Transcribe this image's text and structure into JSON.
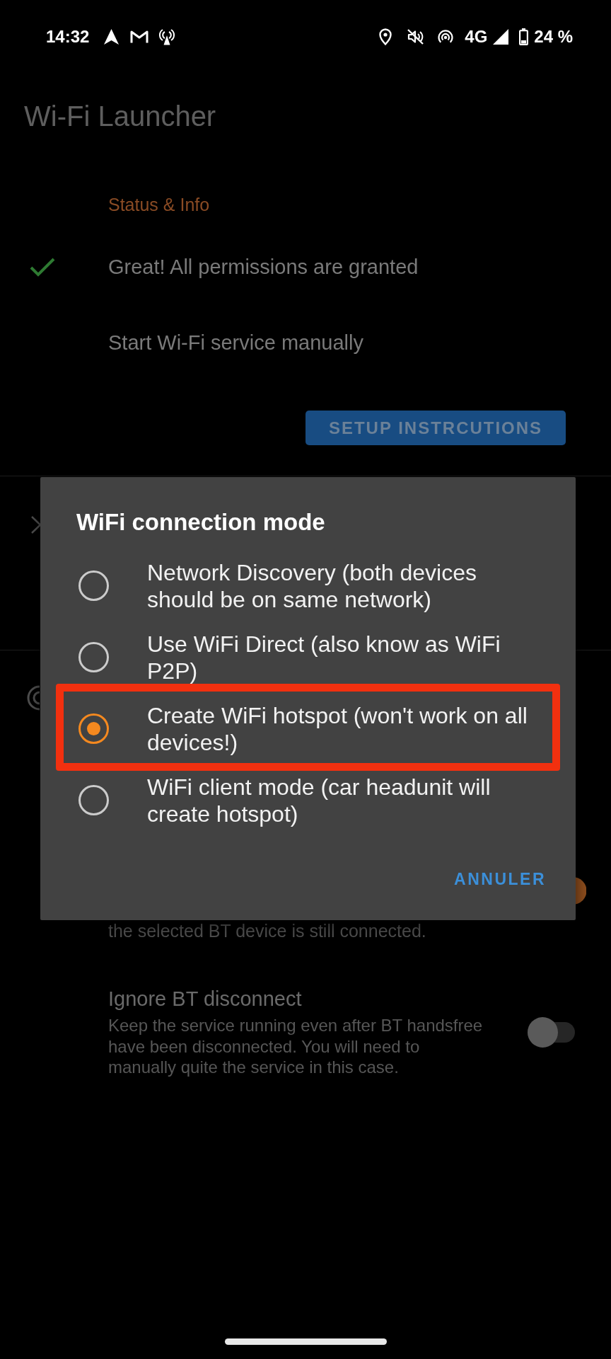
{
  "status_bar": {
    "time": "14:32",
    "network": "4G",
    "battery": "24 %"
  },
  "app_bar": {
    "title": "Wi-Fi Launcher"
  },
  "status_section": {
    "header": "Status & Info",
    "items": [
      {
        "kind": "check",
        "text": "Great! All permissions are granted"
      },
      {
        "kind": "plain",
        "text": "Start Wi-Fi service manually"
      }
    ],
    "button": "SETUP INSTRCUTIONS"
  },
  "covered_setting": {
    "on": true,
    "description_end": "the selected BT device is still connected."
  },
  "settings": [
    {
      "title": "Ignore BT disconnect",
      "description": "Keep the service running even after BT handsfree have been disconnected. You will need to manually quite the service in this case.",
      "on": false
    }
  ],
  "dialog": {
    "title": "WiFi connection mode",
    "options": [
      {
        "label": "Network Discovery (both devices should be on same network)",
        "selected": false,
        "highlighted": false
      },
      {
        "label": "Use WiFi Direct (also know as WiFi P2P)",
        "selected": false,
        "highlighted": false
      },
      {
        "label": "Create WiFi hotspot (won't work on all devices!)",
        "selected": true,
        "highlighted": true
      },
      {
        "label": "WiFi client mode (car headunit will create hotspot)",
        "selected": false,
        "highlighted": false
      }
    ],
    "button": "ANNULER"
  }
}
